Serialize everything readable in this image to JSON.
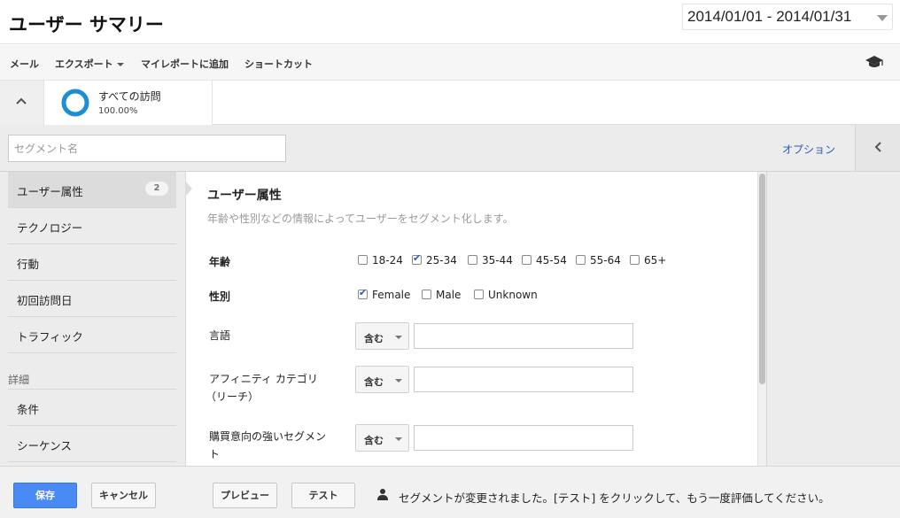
{
  "header": {
    "title": "ユーザー サマリー",
    "date_range": "2014/01/01 - 2014/01/31"
  },
  "toolbar": {
    "items": [
      "メール",
      "エクスポート",
      "マイレポートに追加",
      "ショートカット"
    ],
    "icon": "graduation-cap-icon"
  },
  "segment": {
    "name": "すべての訪問",
    "percent": "100.00%"
  },
  "editor": {
    "name_placeholder": "セグメント名",
    "options_link": "オプション",
    "nav": {
      "items": [
        {
          "label": "ユーザー属性",
          "badge": "2"
        },
        {
          "label": "テクノロジー"
        },
        {
          "label": "行動"
        },
        {
          "label": "初回訪問日"
        },
        {
          "label": "トラフィック"
        }
      ],
      "section": "詳細",
      "advanced": [
        {
          "label": "条件"
        },
        {
          "label": "シーケンス"
        }
      ]
    },
    "content": {
      "title": "ユーザー属性",
      "description": "年齢や性別などの情報によってユーザーをセグメント化します。",
      "age_label": "年齢",
      "ages": [
        {
          "label": "18-24",
          "checked": false
        },
        {
          "label": "25-34",
          "checked": true
        },
        {
          "label": "35-44",
          "checked": false
        },
        {
          "label": "45-54",
          "checked": false
        },
        {
          "label": "55-64",
          "checked": false
        },
        {
          "label": "65+",
          "checked": false
        }
      ],
      "gender_label": "性別",
      "genders": [
        {
          "label": "Female",
          "checked": true
        },
        {
          "label": "Male",
          "checked": false
        },
        {
          "label": "Unknown",
          "checked": false
        }
      ],
      "language_label": "言語",
      "affinity_label_1": "アフィニティ カテゴリ",
      "affinity_label_2": "（リーチ）",
      "inmarket_label_1": "購買意向の強いセグメン",
      "inmarket_label_2": "ト",
      "match_option": "含む"
    }
  },
  "footer": {
    "save": "保存",
    "cancel": "キャンセル",
    "preview": "プレビュー",
    "test": "テスト",
    "message": "セグメントが変更されました。[テスト] をクリックして、もう一度評価してください。"
  },
  "colors": {
    "primary_button": "#4a8af4",
    "link": "#2a5db0",
    "segment_ring": "#1a8fd6"
  }
}
